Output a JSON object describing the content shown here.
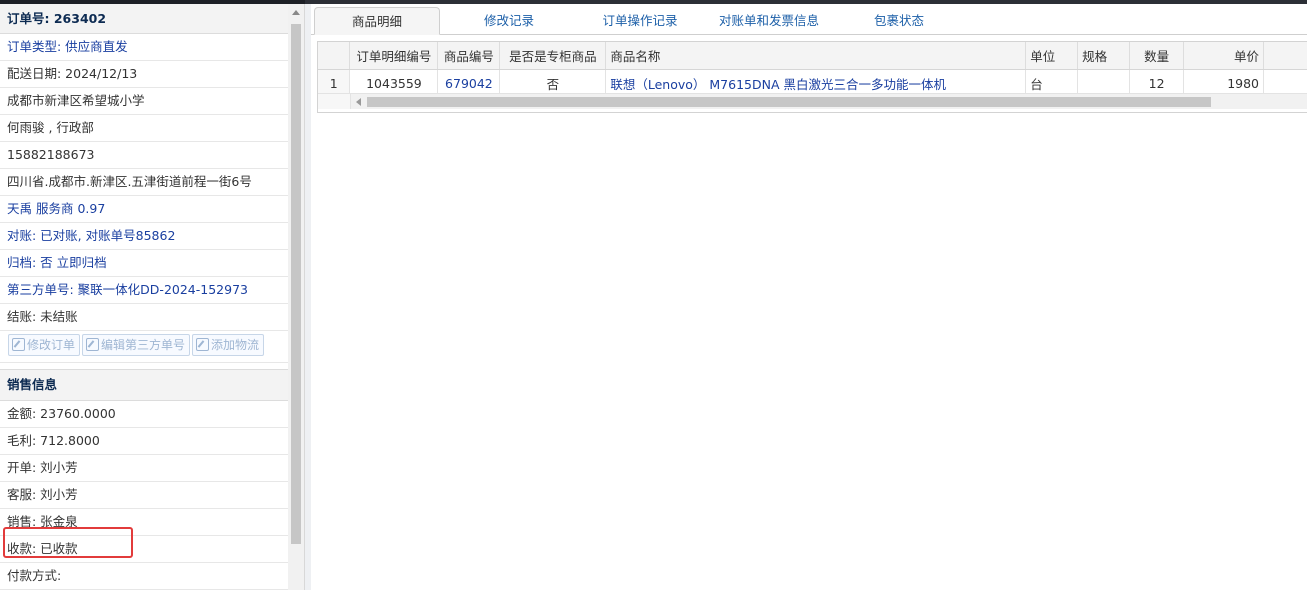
{
  "order": {
    "number_label": "订单号: 263402",
    "fields": [
      {
        "text": "订单类型: 供应商直发",
        "style": "blue"
      },
      {
        "text": "配送日期: 2024/12/13",
        "style": "dark"
      },
      {
        "text": "成都市新津区希望城小学",
        "style": "dark"
      },
      {
        "text": "何雨骏 , 行政部",
        "style": "dark"
      },
      {
        "text": "15882188673",
        "style": "dark"
      },
      {
        "text": "四川省.成都市.新津区.五津街道前程一街6号",
        "style": "dark"
      },
      {
        "text": "天禹 服务商 0.97",
        "style": "blue"
      },
      {
        "text": "对账: 已对账, 对账单号85862",
        "style": "blue"
      },
      {
        "text": "归档:  否 立即归档",
        "style": "blue"
      },
      {
        "text": "第三方单号: 聚联一体化DD-2024-152973",
        "style": "blue"
      },
      {
        "text": "结账: 未结账",
        "style": "dark"
      }
    ],
    "buttons": {
      "edit_order": "修改订单",
      "edit_third_party": "编辑第三方单号",
      "add_logistics": "添加物流"
    }
  },
  "sales": {
    "title": "销售信息",
    "fields": [
      "金额: 23760.0000",
      "毛利: 712.8000",
      "开单: 刘小芳",
      "客服: 刘小芳",
      "销售: 张金泉",
      "收款: 已收款",
      "付款方式:"
    ]
  },
  "tabs": [
    "商品明细",
    "修改记录",
    "订单操作记录",
    "对账单和发票信息",
    "包裹状态"
  ],
  "active_tab": "商品明细",
  "table": {
    "columns": [
      "",
      "订单明细编号",
      "商品编号",
      "是否是专柜商品",
      "商品名称",
      "单位",
      "规格",
      "数量",
      "单价"
    ],
    "rows": [
      [
        "1",
        "1043559",
        "679042",
        "否",
        "联想（Lenovo） M7615DNA 黑白激光三合一多功能一体机",
        "台",
        "",
        "12",
        "1980"
      ]
    ]
  },
  "colors": {
    "link_blue": "#1a3fa0",
    "tab_blue": "#1c5fa8",
    "highlight_red": "#e23b3b"
  }
}
